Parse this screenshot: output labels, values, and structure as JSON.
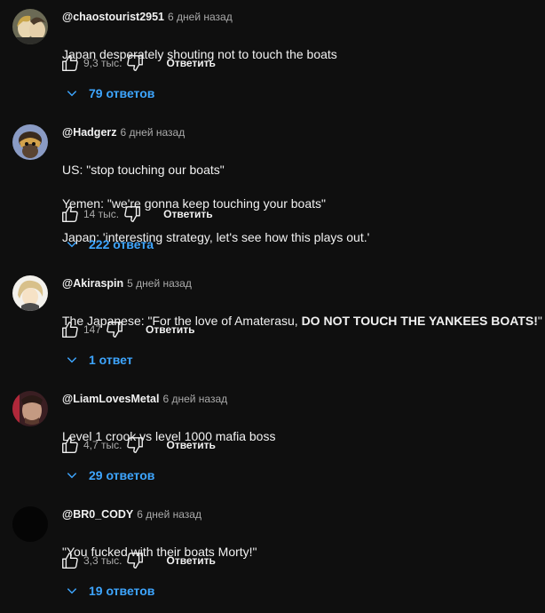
{
  "ui": {
    "reply_label": "Ответить",
    "colors": {
      "background": "#0f0f0f",
      "text": "#f1f1f1",
      "muted": "#aaaaaa",
      "link": "#3ea6ff"
    }
  },
  "comments": [
    {
      "author": "@chaostourist2951",
      "time": "6 дней назад",
      "text_lines": [
        "Japan desperately shouting not to touch the boats"
      ],
      "likes": "9,3 тыс.",
      "replies": "79 ответов",
      "avatar": "anime-avatar-icon"
    },
    {
      "author": "@Hadgerz",
      "time": "6 дней назад",
      "text_lines": [
        "US: \"stop touching our boats\"",
        "Yemen: \"we're gonna keep touching your boats\"",
        "Japan: 'interesting strategy, let's see how this plays out.'"
      ],
      "likes": "14 тыс.",
      "replies": "222 ответа",
      "avatar": "cartoon-avatar-icon"
    },
    {
      "author": "@Akiraspin",
      "time": "5 дней назад",
      "text_plain": "The Japanese: \"For the love of Amaterasu, ",
      "text_bold": "DO NOT TOUCH THE YANKEES BOATS!",
      "text_end": "\"",
      "likes": "147",
      "replies": "1 ответ",
      "avatar": "anime-avatar-icon"
    },
    {
      "author": "@LiamLovesMetal",
      "time": "6 дней назад",
      "text_lines": [
        "Level 1 crook vs level 1000 mafia boss"
      ],
      "likes": "4,7 тыс.",
      "replies": "29 ответов",
      "avatar": "photo-avatar-icon"
    },
    {
      "author": "@BR0_CODY",
      "time": "6 дней назад",
      "text_lines": [
        "\"You fucked with their boats Morty!\""
      ],
      "likes": "3,3 тыс.",
      "replies": "19 ответов",
      "avatar": "dark-avatar-icon"
    }
  ]
}
